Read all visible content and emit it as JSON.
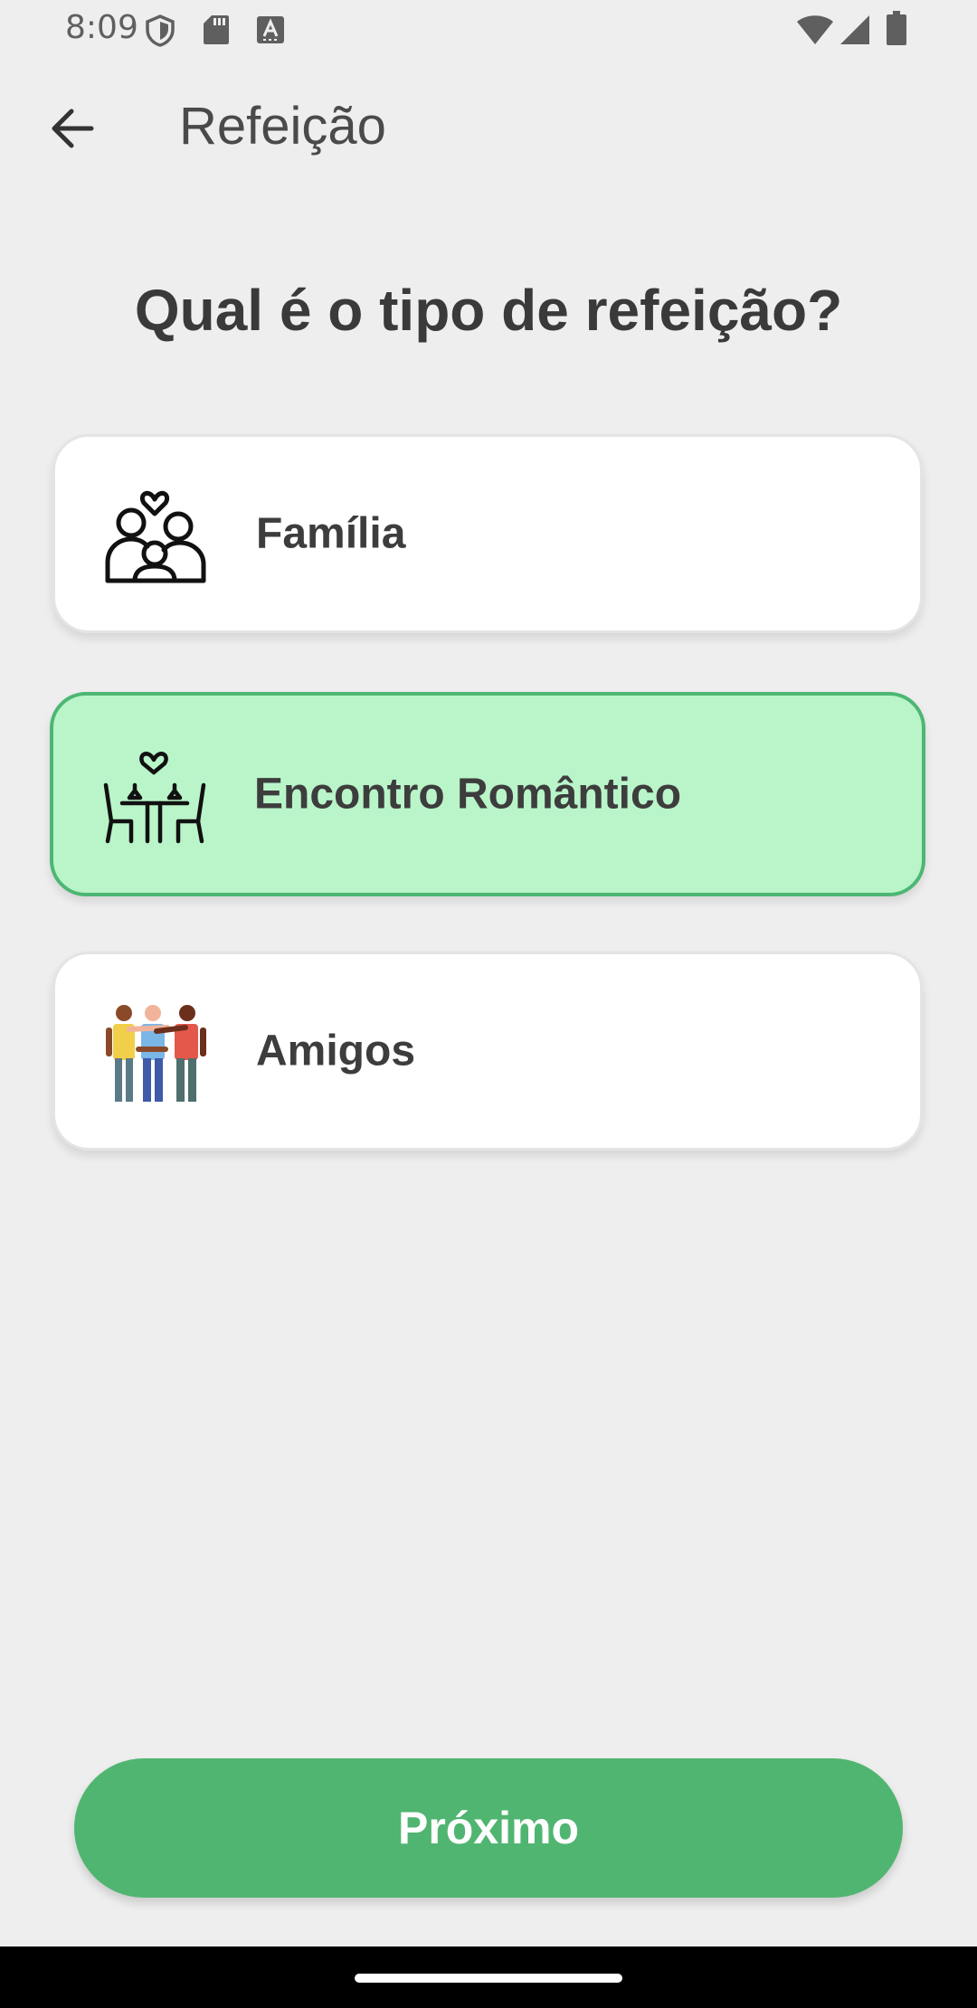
{
  "status_bar": {
    "time": "8:09",
    "left_icons": [
      "shield-icon",
      "sd-card-icon",
      "keyboard-a-icon"
    ],
    "right_icons": [
      "wifi-icon",
      "signal-icon",
      "battery-icon"
    ]
  },
  "app_bar": {
    "back_icon": "arrow-left-icon",
    "title": "Refeição"
  },
  "question": "Qual é o tipo de refeição?",
  "options": [
    {
      "label": "Família",
      "icon": "family-icon",
      "selected": false
    },
    {
      "label": "Encontro Romântico",
      "icon": "romantic-dinner-icon",
      "selected": true
    },
    {
      "label": "Amigos",
      "icon": "friends-icon",
      "selected": false
    }
  ],
  "next_button": {
    "label": "Próximo"
  },
  "colors": {
    "background": "#eeeeee",
    "accent_green": "#50b571",
    "selected_fill": "#b9f5c9",
    "selected_border": "#4db673"
  }
}
